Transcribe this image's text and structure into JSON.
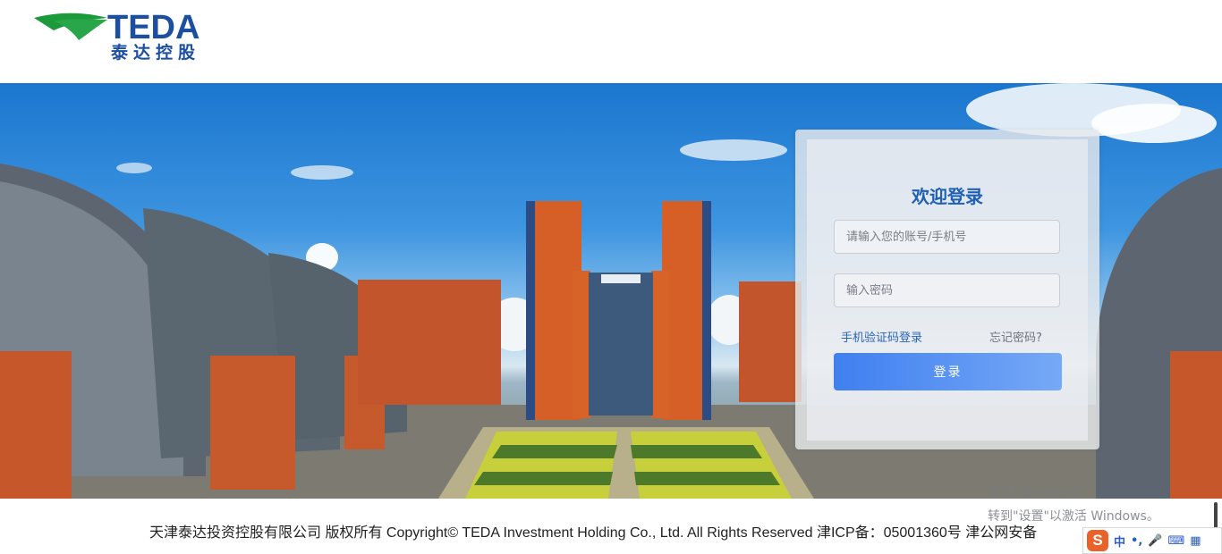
{
  "logo": {
    "en": "TEDA",
    "cn": "泰达控股"
  },
  "login": {
    "title": "欢迎登录",
    "account_placeholder": "请输入您的账号/手机号",
    "password_placeholder": "输入密码",
    "sms_login_link": "手机验证码登录",
    "forgot_password_link": "忘记密码?",
    "submit_label": "登录"
  },
  "footer": {
    "copyright": "天津泰达投资控股有限公司 版权所有 Copyright© TEDA Investment Holding Co., Ltd. All Rights Reserved 津ICP备：05001360号 津公网安备"
  },
  "os_overlay": {
    "watermark_line1": "激活 Windows",
    "watermark_line2": "转到\"设置\"以激活 Windows。",
    "ime_logo": "S",
    "ime_mode": "中",
    "ime_punct": "•,",
    "ime_mic": "🎤",
    "ime_keyboard": "⌨",
    "ime_grid": "▦"
  },
  "colors": {
    "brand_blue": "#1d4fa0",
    "brand_green": "#1b9a3c",
    "button_start": "#3f7ff0",
    "button_end": "#76a9f6"
  }
}
